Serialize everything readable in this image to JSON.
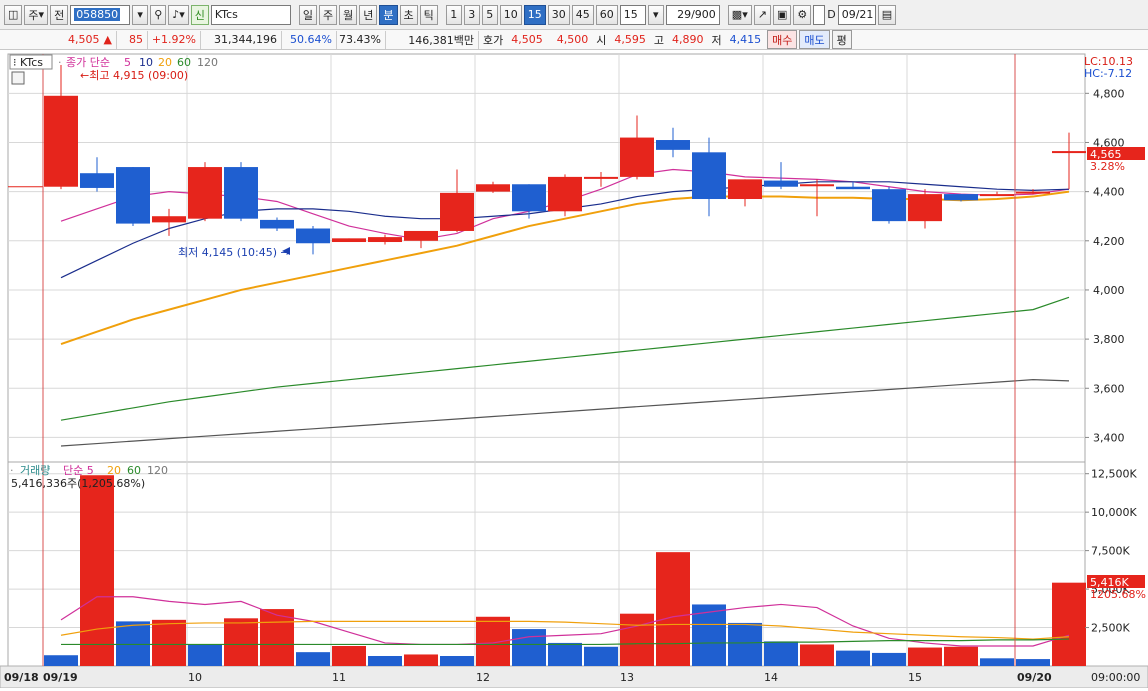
{
  "toolbar": {
    "period_type": "주",
    "prev_label": "전",
    "stock_code": "058850",
    "badge_label": "신",
    "stock_name": "KTcs",
    "period_tabs": [
      "일",
      "주",
      "월",
      "년",
      "분",
      "초",
      "틱"
    ],
    "active_period": "분",
    "interval_buttons": [
      "1",
      "3",
      "5",
      "10",
      "15",
      "30",
      "45",
      "60"
    ],
    "active_interval": "15",
    "interval_select": "15",
    "count": "29/900",
    "checkbox_label": "D",
    "date": "09/21"
  },
  "quote": {
    "price": "4,505",
    "arrow": "▲",
    "change": "85",
    "change_pct": "+1.92%",
    "volume": "31,344,196",
    "vol_ratio": "50.64%",
    "rate2": "73.43%",
    "amount": "146,381백만",
    "ask_label": "호가",
    "ask1": "4,505",
    "ask2": "4,500",
    "open_label": "시",
    "open": "4,595",
    "high_label": "고",
    "high": "4,890",
    "low_label": "저",
    "low": "4,415",
    "buy_label": "매수",
    "sell_label": "매도",
    "eval_label": "평"
  },
  "price_panel": {
    "stock_tag": "KTcs",
    "legend_title": "종가 단순",
    "ma_periods": [
      "5",
      "10",
      "20",
      "60",
      "120"
    ],
    "high_annotation": "←최고 4,915 (09:00)",
    "low_annotation": "최저 4,145 (10:45) →",
    "lc": "LC:10.13",
    "hc": "HC:-7.12",
    "last_price_label": "4,565",
    "last_pct_label": "3.28%"
  },
  "volume_panel": {
    "legend_title": "거래량",
    "ma_label": "단순 5",
    "ma_periods": [
      "20",
      "60",
      "120"
    ],
    "summary": "5,416,336주(1,205.68%)",
    "last_vol_label": "5,416K",
    "last_pct_label": "1205.68%"
  },
  "x_axis": {
    "left_date": "09/18",
    "right_date": "09/19",
    "day_labels": [
      "10",
      "11",
      "12",
      "13",
      "14",
      "15"
    ],
    "next_date": "09/20",
    "time_label": "09:00:00"
  },
  "colors": {
    "up": "#e6251c",
    "down": "#1f5fd0",
    "ma5": "#d0309a",
    "ma10": "#1a2d8c",
    "ma20": "#f0a00c",
    "ma60": "#2a8a2a",
    "ma120": "#555555",
    "grid": "#d8d8d8"
  },
  "chart_data": [
    {
      "type": "candlestick",
      "title": "KTcs",
      "y_ticks": [
        3400,
        3600,
        3800,
        4000,
        4200,
        4400,
        4600,
        4800
      ],
      "ylim": [
        3300,
        4960
      ],
      "candles": [
        {
          "open": 4420,
          "high": 4915,
          "low": 4410,
          "close": 4790
        },
        {
          "open": 4475,
          "high": 4540,
          "low": 4400,
          "close": 4415
        },
        {
          "open": 4500,
          "high": 4500,
          "low": 4260,
          "close": 4270
        },
        {
          "open": 4275,
          "high": 4330,
          "low": 4220,
          "close": 4300
        },
        {
          "open": 4290,
          "high": 4520,
          "low": 4280,
          "close": 4500
        },
        {
          "open": 4500,
          "high": 4520,
          "low": 4280,
          "close": 4290
        },
        {
          "open": 4285,
          "high": 4295,
          "low": 4240,
          "close": 4250
        },
        {
          "open": 4250,
          "high": 4260,
          "low": 4145,
          "close": 4190
        },
        {
          "open": 4195,
          "high": 4210,
          "low": 4195,
          "close": 4210
        },
        {
          "open": 4195,
          "high": 4225,
          "low": 4185,
          "close": 4215
        },
        {
          "open": 4200,
          "high": 4240,
          "low": 4170,
          "close": 4240
        },
        {
          "open": 4240,
          "high": 4490,
          "low": 4235,
          "close": 4395
        },
        {
          "open": 4400,
          "high": 4440,
          "low": 4395,
          "close": 4430
        },
        {
          "open": 4430,
          "high": 4430,
          "low": 4290,
          "close": 4320
        },
        {
          "open": 4320,
          "high": 4470,
          "low": 4300,
          "close": 4460
        },
        {
          "open": 4460,
          "high": 4480,
          "low": 4420,
          "close": 4460
        },
        {
          "open": 4460,
          "high": 4710,
          "low": 4450,
          "close": 4620
        },
        {
          "open": 4610,
          "high": 4660,
          "low": 4540,
          "close": 4570
        },
        {
          "open": 4560,
          "high": 4620,
          "low": 4300,
          "close": 4370
        },
        {
          "open": 4370,
          "high": 4450,
          "low": 4340,
          "close": 4450
        },
        {
          "open": 4445,
          "high": 4520,
          "low": 4410,
          "close": 4420
        },
        {
          "open": 4430,
          "high": 4450,
          "low": 4300,
          "close": 4430
        },
        {
          "open": 4420,
          "high": 4440,
          "low": 4410,
          "close": 4410
        },
        {
          "open": 4410,
          "high": 4420,
          "low": 4270,
          "close": 4280
        },
        {
          "open": 4280,
          "high": 4410,
          "low": 4250,
          "close": 4390
        },
        {
          "open": 4390,
          "high": 4390,
          "low": 4360,
          "close": 4365
        },
        {
          "open": 4390,
          "high": 4400,
          "low": 4390,
          "close": 4390
        },
        {
          "open": 4400,
          "high": 4410,
          "low": 4390,
          "close": 4400
        },
        {
          "open": 4560,
          "high": 4640,
          "low": 4410,
          "close": 4565
        }
      ],
      "ma": [
        {
          "name": "5",
          "color": "#d0309a",
          "values": [
            4280,
            4330,
            4380,
            4400,
            4390,
            4380,
            4360,
            4310,
            4260,
            4230,
            4205,
            4230,
            4290,
            4320,
            4360,
            4410,
            4470,
            4490,
            4480,
            4460,
            4455,
            4450,
            4440,
            4420,
            4400,
            4390,
            4385,
            4390,
            4410
          ]
        },
        {
          "name": "10",
          "color": "#1a2d8c",
          "values": [
            4050,
            4120,
            4190,
            4250,
            4290,
            4320,
            4330,
            4330,
            4320,
            4300,
            4290,
            4290,
            4300,
            4310,
            4330,
            4350,
            4380,
            4400,
            4410,
            4420,
            4430,
            4440,
            4440,
            4440,
            4430,
            4420,
            4410,
            4405,
            4410
          ]
        },
        {
          "name": "20",
          "color": "#f0a00c",
          "values": [
            3780,
            3830,
            3880,
            3920,
            3960,
            4000,
            4030,
            4060,
            4090,
            4120,
            4150,
            4180,
            4220,
            4260,
            4290,
            4320,
            4350,
            4370,
            4380,
            4380,
            4380,
            4375,
            4375,
            4370,
            4370,
            4365,
            4370,
            4380,
            4400
          ]
        },
        {
          "name": "60",
          "color": "#2a8a2a",
          "values": [
            3470,
            3495,
            3520,
            3545,
            3565,
            3585,
            3605,
            3620,
            3635,
            3650,
            3665,
            3680,
            3695,
            3710,
            3725,
            3740,
            3755,
            3770,
            3785,
            3800,
            3815,
            3830,
            3845,
            3860,
            3875,
            3890,
            3905,
            3920,
            3970
          ]
        },
        {
          "name": "120",
          "color": "#555555",
          "values": [
            3365,
            3375,
            3385,
            3395,
            3405,
            3415,
            3425,
            3435,
            3445,
            3455,
            3465,
            3475,
            3485,
            3495,
            3505,
            3515,
            3525,
            3535,
            3545,
            3555,
            3565,
            3575,
            3585,
            3595,
            3605,
            3615,
            3625,
            3635,
            3630
          ]
        }
      ]
    },
    {
      "type": "bar",
      "title": "거래량",
      "y_ticks": [
        "2,500K",
        "5,000K",
        "7,500K",
        "10,000K",
        "12,500K"
      ],
      "ylim": [
        0,
        13000
      ],
      "values": [
        700,
        12400,
        2900,
        3000,
        1400,
        3100,
        3700,
        900,
        1300,
        650,
        750,
        650,
        3200,
        2400,
        1500,
        1250,
        3400,
        7400,
        4000,
        2800,
        1600,
        1400,
        1000,
        850,
        1200,
        1250,
        500,
        450,
        5416
      ],
      "up": [
        false,
        true,
        false,
        true,
        false,
        true,
        true,
        false,
        true,
        false,
        true,
        false,
        true,
        false,
        false,
        false,
        true,
        true,
        false,
        false,
        false,
        true,
        false,
        false,
        true,
        true,
        false,
        false,
        true
      ],
      "ma": [
        {
          "name": "5",
          "color": "#d0309a",
          "values": [
            3000,
            4500,
            4500,
            4200,
            4000,
            4200,
            3300,
            2900,
            2200,
            1500,
            1400,
            1400,
            1500,
            1900,
            2000,
            2100,
            2600,
            3200,
            3500,
            3800,
            4000,
            3800,
            2600,
            1800,
            1500,
            1300,
            1300,
            1300,
            2000
          ]
        },
        {
          "name": "20",
          "color": "#f0a00c",
          "values": [
            2000,
            2400,
            2650,
            2750,
            2800,
            2800,
            2850,
            2900,
            2900,
            2900,
            2900,
            2900,
            2900,
            2900,
            2850,
            2750,
            2650,
            2700,
            2700,
            2700,
            2600,
            2400,
            2200,
            2100,
            2000,
            1900,
            1850,
            1750,
            1900
          ]
        },
        {
          "name": "60",
          "color": "#2a8a2a",
          "values": [
            1400,
            1400,
            1400,
            1400,
            1400,
            1400,
            1400,
            1400,
            1400,
            1400,
            1400,
            1400,
            1400,
            1400,
            1400,
            1400,
            1450,
            1450,
            1500,
            1500,
            1550,
            1550,
            1600,
            1650,
            1650,
            1650,
            1700,
            1700,
            1750
          ]
        }
      ]
    }
  ]
}
